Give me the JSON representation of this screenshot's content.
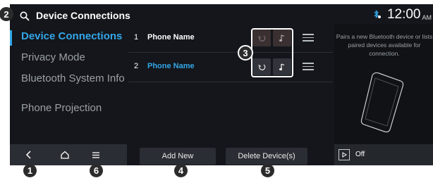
{
  "header": {
    "title": "Device Connections",
    "clock": "12:00",
    "ampm": "AM"
  },
  "sidebar": {
    "items": [
      {
        "label": "Device Connections",
        "active": true
      },
      {
        "label": "Privacy Mode",
        "active": false
      },
      {
        "label": "Bluetooth System Info",
        "active": false
      },
      {
        "label": "Phone Projection",
        "active": false
      }
    ]
  },
  "bottom_nav": {
    "icons": [
      "back-icon",
      "home-icon",
      "menu-icon"
    ]
  },
  "device_list": [
    {
      "number": "1",
      "name": "Phone Name",
      "connected": false
    },
    {
      "number": "2",
      "name": "Phone Name",
      "connected": true
    }
  ],
  "actions": {
    "add_new": "Add New",
    "delete_devices": "Delete Device(s)"
  },
  "right_panel": {
    "description": "Pairs a new Bluetooth device or lists paired devices available for connection.",
    "playback_state": "Off"
  },
  "callouts": {
    "c1": "1",
    "c2": "2",
    "c3": "3",
    "c4": "4",
    "c5": "5",
    "c6": "6"
  },
  "colors": {
    "accent": "#33a7e8",
    "background": "#14161b",
    "button": "#2a2d33"
  }
}
